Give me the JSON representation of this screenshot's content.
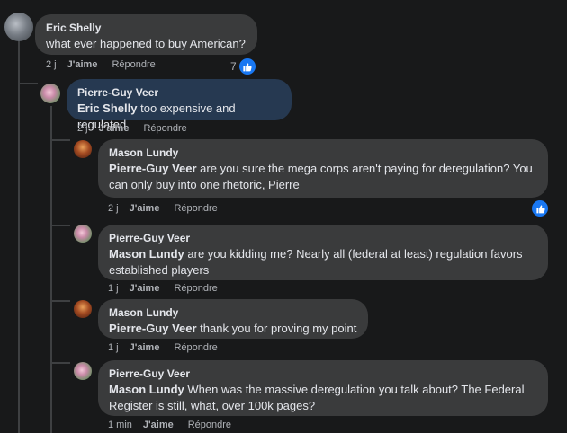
{
  "comments": [
    {
      "author": "Eric Shelly",
      "mention": "",
      "text": "what ever happened to buy American?",
      "time": "2 j",
      "like": "J'aime",
      "reply": "Répondre",
      "reactions": "7"
    },
    {
      "author": "Pierre-Guy Veer",
      "mention": "Eric Shelly",
      "text": " too expensive and regulated",
      "time": "2 j",
      "like": "J'aime",
      "reply": "Répondre"
    },
    {
      "author": "Mason Lundy",
      "mention": "Pierre-Guy Veer",
      "text": " are you sure the mega corps aren't paying for deregulation? You can only buy into one rhetoric, Pierre",
      "time": "2 j",
      "like": "J'aime",
      "reply": "Répondre"
    },
    {
      "author": "Pierre-Guy Veer",
      "mention": "Mason Lundy",
      "text": " are you kidding me? Nearly all (federal at least) regulation favors established players",
      "time": "1 j",
      "like": "J'aime",
      "reply": "Répondre"
    },
    {
      "author": "Mason Lundy",
      "mention": "Pierre-Guy Veer",
      "text": " thank you for proving my point",
      "time": "1 j",
      "like": "J'aime",
      "reply": "Répondre"
    },
    {
      "author": "Pierre-Guy Veer",
      "mention": "Mason Lundy",
      "text": " When was the massive deregulation you talk about? The Federal Register is still, what, over 100k pages?",
      "time": "1 min",
      "like": "J'aime",
      "reply": "Répondre"
    }
  ],
  "colors": {
    "bubble": "#3a3b3c",
    "highlight_bubble": "#263951",
    "like_blue": "#1877f2"
  },
  "icons": {
    "reaction": "thumbs-up-icon"
  }
}
